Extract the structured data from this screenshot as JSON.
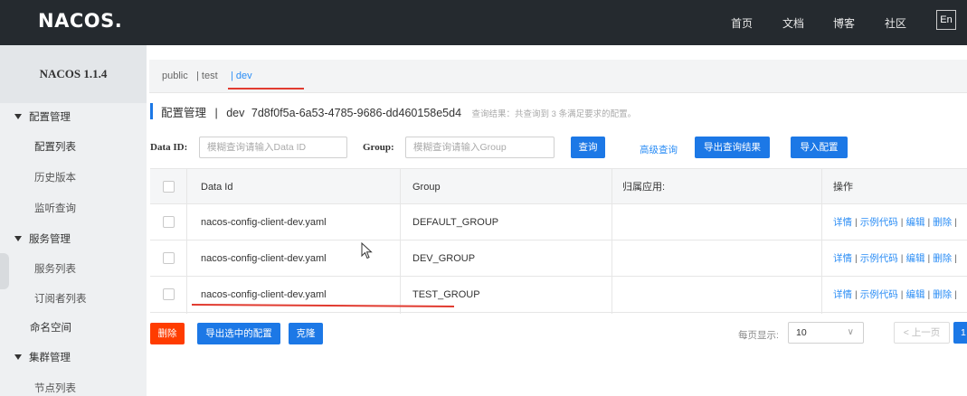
{
  "topbar": {
    "logo": "NACOS.",
    "nav": [
      "首页",
      "文档",
      "博客",
      "社区"
    ],
    "lang": "En"
  },
  "sidebar": {
    "title": "NACOS 1.1.4",
    "groups": [
      {
        "label": "配置管理",
        "items": [
          "配置列表",
          "历史版本",
          "监听查询"
        ]
      },
      {
        "label": "服务管理",
        "items": [
          "服务列表",
          "订阅者列表"
        ]
      },
      {
        "label": "命名空间"
      },
      {
        "label": "集群管理",
        "items": [
          "节点列表"
        ]
      }
    ]
  },
  "namespaces": {
    "items": [
      "public",
      "| test",
      "| dev"
    ],
    "active": "dev"
  },
  "header": {
    "title": "配置管理",
    "separator": "|",
    "namespace": "dev",
    "namespace_id": "7d8f0f5a-6a53-4785-9686-dd460158e5d4",
    "result_text": "查询结果：共查询到 3 条满足要求的配置。"
  },
  "search": {
    "data_id_label": "Data ID:",
    "data_id_placeholder": "模糊查询请输入Data ID",
    "group_label": "Group:",
    "group_placeholder": "模糊查询请输入Group",
    "query_button": "查询",
    "advanced_query": "高级查询",
    "export_results_button": "导出查询结果",
    "import_button": "导入配置"
  },
  "table": {
    "columns": [
      "Data Id",
      "Group",
      "归属应用:",
      "操作"
    ],
    "rows": [
      {
        "data_id": "nacos-config-client-dev.yaml",
        "group": "DEFAULT_GROUP",
        "app": ""
      },
      {
        "data_id": "nacos-config-client-dev.yaml",
        "group": "DEV_GROUP",
        "app": ""
      },
      {
        "data_id": "nacos-config-client-dev.yaml",
        "group": "TEST_GROUP",
        "app": ""
      }
    ],
    "actions": [
      "详情",
      "示例代码",
      "编辑",
      "删除"
    ],
    "action_separator": "|"
  },
  "footer": {
    "delete_button": "删除",
    "export_selected_button": "导出选中的配置",
    "clone_button": "克隆",
    "page_size_label": "每页显示:",
    "page_size": "10",
    "prev_page": "< 上一页",
    "current_page": "1"
  },
  "colors": {
    "topbar": "#252a2f",
    "primary": "#1c78e6",
    "link": "#2b8df5",
    "danger": "#ff3c00",
    "annotation": "#e13b30"
  }
}
